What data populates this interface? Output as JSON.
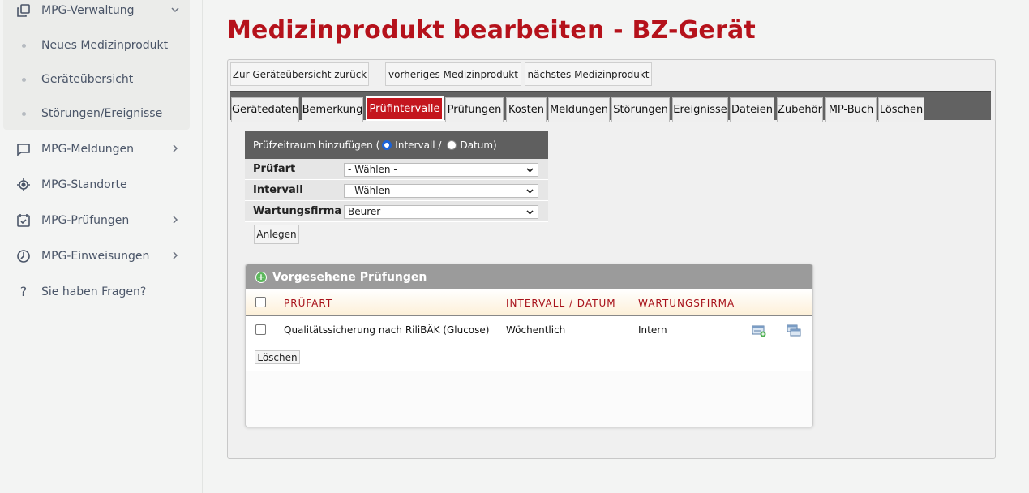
{
  "sidebar": {
    "groups": [
      {
        "label": "MPG-Verwaltung",
        "icon": "copy-icon",
        "expanded": true,
        "items": [
          "Neues Medizinprodukt",
          "Geräteübersicht",
          "Störungen/Ereignisse"
        ]
      },
      {
        "label": "MPG-Meldungen",
        "icon": "chat-icon"
      },
      {
        "label": "MPG-Standorte",
        "icon": "target-icon"
      },
      {
        "label": "MPG-Prüfungen",
        "icon": "calendar-check-icon"
      },
      {
        "label": "MPG-Einweisungen",
        "icon": "clock-icon"
      },
      {
        "label": "Sie haben Fragen?",
        "icon": "question-icon"
      }
    ]
  },
  "page": {
    "title": "Medizinprodukt bearbeiten - BZ-Gerät",
    "accent": "#b5121b"
  },
  "nav_buttons": {
    "back": "Zur Geräteübersicht zurück",
    "prev": "vorheriges Medizinprodukt",
    "next": "nächstes Medizinprodukt"
  },
  "tabs": [
    "Gerätedaten",
    "Bemerkung",
    "Prüfintervalle",
    "Prüfungen",
    "Kosten",
    "Meldungen",
    "Störungen",
    "Ereignisse",
    "Dateien",
    "Zubehör",
    "MP-Buch",
    "Löschen"
  ],
  "active_tab": "Prüfintervalle",
  "add_form": {
    "header": "Prüfzeitraum hinzufügen (",
    "radio_interval": "Intervall /",
    "radio_date": "Datum)",
    "selected_mode": "Intervall",
    "rows": [
      {
        "label": "Prüfart",
        "value": "- Wählen -"
      },
      {
        "label": "Intervall",
        "value": "- Wählen -"
      },
      {
        "label": "Wartungsfirma",
        "value": "Beurer"
      }
    ],
    "submit": "Anlegen"
  },
  "planned": {
    "title": "Vorgesehene Prüfungen",
    "columns": [
      "PRÜFART",
      "INTERVALL / DATUM",
      "WARTUNGSFIRMA"
    ],
    "rows": [
      {
        "pruefart": "Qualitätssicherung nach RiliBÄK (Glucose)",
        "intervall": "Wöchentlich",
        "firma": "Intern"
      }
    ],
    "delete": "Löschen"
  }
}
